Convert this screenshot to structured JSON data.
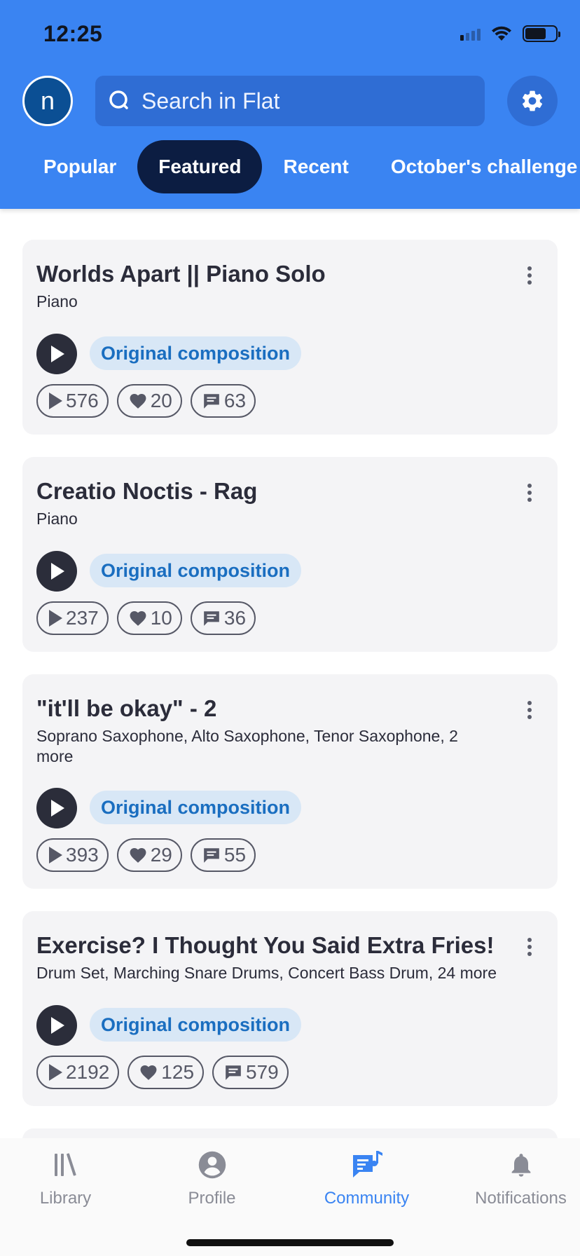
{
  "status_bar": {
    "time": "12:25"
  },
  "header": {
    "avatar_letter": "n",
    "search_placeholder": "Search in Flat",
    "tabs": [
      {
        "label": "Popular",
        "active": false
      },
      {
        "label": "Featured",
        "active": true
      },
      {
        "label": "Recent",
        "active": false
      },
      {
        "label": "October's challenge",
        "active": false
      }
    ]
  },
  "colors": {
    "header_bg": "#3a84f2",
    "active_tab": "#0c1d42",
    "tag_bg": "#d8e7f6",
    "tag_text": "#1a6ec0",
    "card_bg": "#f4f4f6"
  },
  "feed": [
    {
      "title": "Worlds Apart || Piano Solo",
      "instruments": "Piano",
      "tag": "Original composition",
      "plays": "576",
      "likes": "20",
      "comments": "63"
    },
    {
      "title": "Creatio Noctis - Rag",
      "instruments": "Piano",
      "tag": "Original composition",
      "plays": "237",
      "likes": "10",
      "comments": "36"
    },
    {
      "title": "\"it'll be okay\" - 2",
      "instruments": "Soprano Saxophone, Alto Saxophone, Tenor Saxophone, 2 more",
      "tag": "Original composition",
      "plays": "393",
      "likes": "29",
      "comments": "55"
    },
    {
      "title": "Exercise? I Thought You Said Extra Fries!",
      "instruments": "Drum Set, Marching Snare Drums, Concert Bass Drum, 24 more",
      "tag": "Original composition",
      "plays": "2192",
      "likes": "125",
      "comments": "579"
    }
  ],
  "bottom_nav": [
    {
      "label": "Library",
      "icon": "library-icon",
      "active": false
    },
    {
      "label": "Profile",
      "icon": "profile-icon",
      "active": false
    },
    {
      "label": "Community",
      "icon": "community-icon",
      "active": true
    },
    {
      "label": "Notifications",
      "icon": "bell-icon",
      "active": false
    }
  ]
}
